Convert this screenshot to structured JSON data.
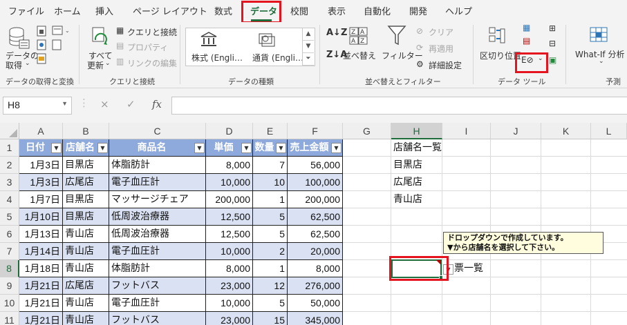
{
  "menu": {
    "tabs": [
      "ファイル",
      "ホーム",
      "挿入",
      "ページ レイアウト",
      "数式",
      "データ",
      "校閲",
      "表示",
      "自動化",
      "開発",
      "ヘルプ"
    ],
    "active_tab": "データ"
  },
  "ribbon": {
    "get_data": {
      "label_line1": "データの",
      "label_line2": "取得",
      "group": "データの取得と変換"
    },
    "queries": {
      "refresh_line1": "すべて",
      "refresh_line2": "更新",
      "queries_connections": "クエリと接続",
      "properties": "プロパティ",
      "edit_links": "リンクの編集",
      "group": "クエリと接続"
    },
    "data_types": {
      "stocks": "株式 (Engli…",
      "currencies": "通貨 (Engli…",
      "group": "データの種類"
    },
    "sort_filter": {
      "sort": "並べ替え",
      "filter": "フィルター",
      "clear": "クリア",
      "reapply": "再適用",
      "advanced": "詳細設定",
      "group": "並べ替えとフィルター"
    },
    "data_tools": {
      "text_to_columns": "区切り位置",
      "group": "データ ツール"
    },
    "forecast": {
      "whatif": "What-If 分析",
      "group": "予測"
    }
  },
  "formula_bar": {
    "name_box": "H8",
    "fx": "fx",
    "cancel": "×",
    "enter": "✓",
    "formula": ""
  },
  "columns": [
    "A",
    "B",
    "C",
    "D",
    "E",
    "F",
    "G",
    "H",
    "I",
    "J",
    "K",
    "L"
  ],
  "rows": [
    "1",
    "2",
    "3",
    "4",
    "5",
    "6",
    "7",
    "8",
    "9",
    "10",
    "11"
  ],
  "table": {
    "headers": [
      "日付",
      "店舗名",
      "商品名",
      "単価",
      "数量",
      "売上金額"
    ],
    "rows": [
      [
        "1月3日",
        "目黒店",
        "体脂肪計",
        "8,000",
        "7",
        "56,000"
      ],
      [
        "1月3日",
        "広尾店",
        "電子血圧計",
        "10,000",
        "10",
        "100,000"
      ],
      [
        "1月7日",
        "目黒店",
        "マッサージチェア",
        "200,000",
        "1",
        "200,000"
      ],
      [
        "1月10日",
        "目黒店",
        "低周波治療器",
        "12,500",
        "5",
        "62,500"
      ],
      [
        "1月13日",
        "青山店",
        "低周波治療器",
        "12,500",
        "5",
        "62,500"
      ],
      [
        "1月14日",
        "青山店",
        "電子血圧計",
        "10,000",
        "2",
        "20,000"
      ],
      [
        "1月18日",
        "青山店",
        "体脂肪計",
        "8,000",
        "1",
        "8,000"
      ],
      [
        "1月21日",
        "広尾店",
        "フットバス",
        "23,000",
        "12",
        "276,000"
      ],
      [
        "1月21日",
        "青山店",
        "電子血圧計",
        "10,000",
        "5",
        "50,000"
      ],
      [
        "1月21日",
        "青山店",
        "フットバス",
        "23,000",
        "15",
        "345,000"
      ]
    ]
  },
  "store_list": {
    "title": "店舗名一覧",
    "items": [
      "目黒店",
      "広尾店",
      "青山店"
    ]
  },
  "tooltip": {
    "line1": "ドロップダウンで作成しています。",
    "line2": "▼から店舗名を選択して下さい。"
  },
  "i8_text": "票一覧",
  "colors": {
    "accent": "#1e6b3b",
    "highlight": "#e4131e",
    "table_header": "#8ea9db",
    "table_band": "#d9e1f2"
  }
}
